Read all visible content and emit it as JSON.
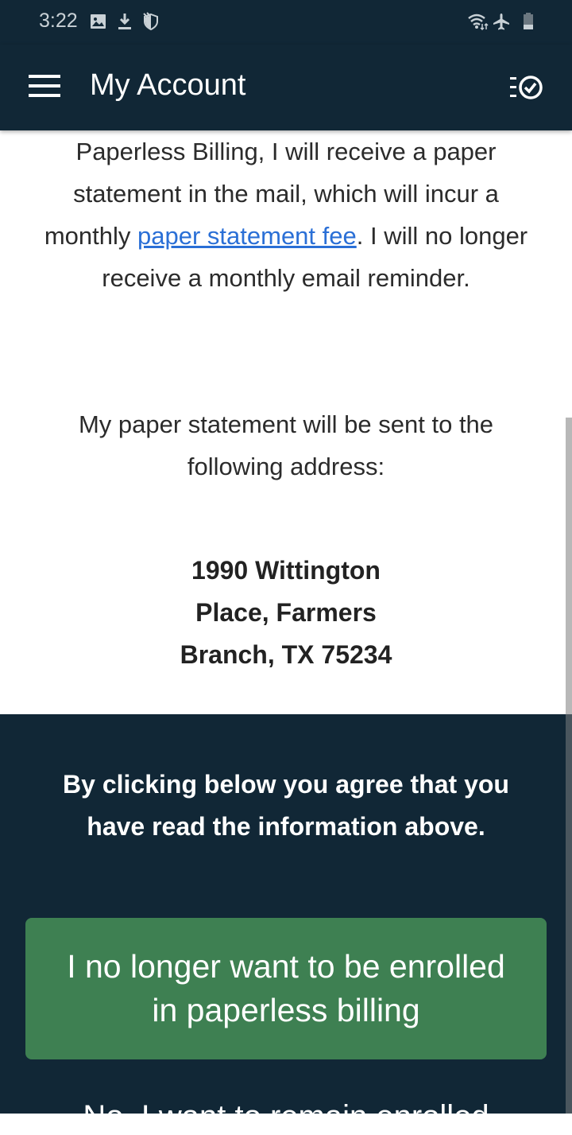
{
  "status_bar": {
    "time": "3:22",
    "left_icons": [
      "image-icon",
      "download-icon",
      "shield-icon"
    ],
    "right_icons": [
      "wifi-icon",
      "airplane-mode-icon",
      "battery-icon"
    ]
  },
  "app_bar": {
    "title": "My Account",
    "menu_icon": "hamburger-menu-icon",
    "action_icon": "task-list-check-icon"
  },
  "content": {
    "paragraph1_before_link": "Paperless Billing, I will receive a paper statement in the mail, which will incur a monthly ",
    "paragraph1_link": "paper statement fee",
    "paragraph1_after_link": ". I will no longer receive a monthly email reminder.",
    "paragraph2": "My paper statement will be sent to the following address:",
    "address_line1": "1990 Wittington",
    "address_line2": "Place, Farmers",
    "address_line3": "Branch, TX 75234"
  },
  "agreement": {
    "text": "By clicking below you agree that you have read the information above.",
    "unenroll_button": "I no longer want to be enrolled in paperless billing",
    "remain_link": "No, I want to remain enrolled"
  },
  "colors": {
    "brand_dark": "#112736",
    "button_green": "#3e8052",
    "link_blue": "#2a6fd6"
  }
}
